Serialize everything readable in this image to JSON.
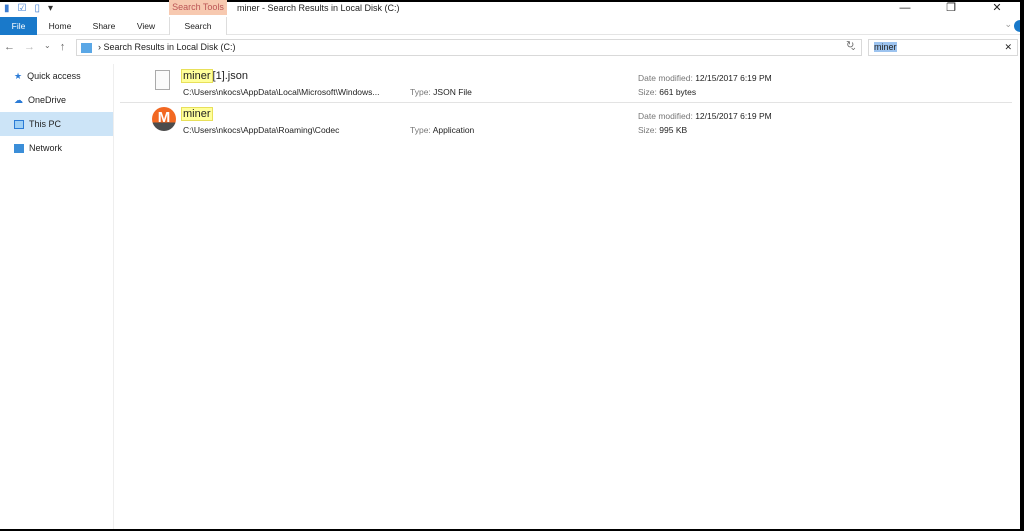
{
  "window": {
    "title": "miner - Search Results in Local Disk (C:)",
    "minimize": "—",
    "restore": "❐",
    "close": "✕"
  },
  "ribbon": {
    "context_tab": "Search Tools",
    "tabs": [
      "File",
      "Home",
      "Share",
      "View",
      "Search"
    ],
    "expand": "⌄"
  },
  "address": {
    "path": "Search Results in Local Disk (C:)",
    "search_value": "miner"
  },
  "sidebar": {
    "items": [
      "Quick access",
      "OneDrive",
      "This PC",
      "Network"
    ]
  },
  "results": [
    {
      "name_hl": "miner",
      "name_rest": "[1].json",
      "path": "C:\\Users\\nkocs\\AppData\\Local\\Microsoft\\Windows...",
      "type_label": "Type:",
      "type": "JSON File",
      "date_label": "Date modified:",
      "date": "12/15/2017 6:19 PM",
      "size_label": "Size:",
      "size": "661 bytes"
    },
    {
      "name_hl": "miner",
      "name_rest": "",
      "path": "C:\\Users\\nkocs\\AppData\\Roaming\\Codec",
      "type_label": "Type:",
      "type": "Application",
      "date_label": "Date modified:",
      "date": "12/15/2017 6:19 PM",
      "size_label": "Size:",
      "size": "995 KB"
    }
  ]
}
